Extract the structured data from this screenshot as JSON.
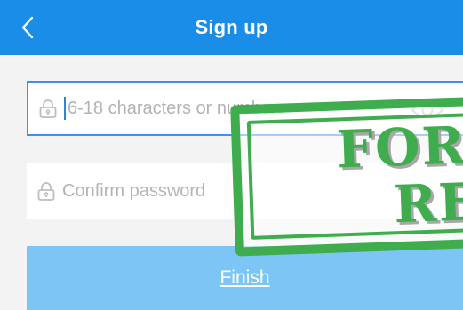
{
  "header": {
    "title": "Sign up",
    "background": "#1a8de8"
  },
  "form": {
    "password": {
      "placeholder": "6-18 characters or numbers",
      "value": "",
      "icon": "lock-icon",
      "toggle_icon": "eye-icon"
    },
    "confirm": {
      "placeholder": "Confirm password",
      "value": "",
      "icon": "lock-icon"
    },
    "finish_label": "Finish",
    "finish_color": "#7cc5f5"
  },
  "watermark": {
    "line1": "FOR",
    "line2": "RE",
    "color": "#3fad4e"
  }
}
